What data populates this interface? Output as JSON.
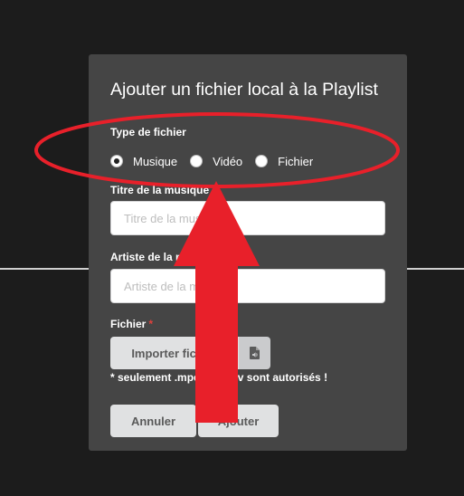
{
  "modal": {
    "title": "Ajouter un fichier local à la Playlist",
    "type_label": "Type de fichier",
    "radios": [
      {
        "label": "Musique",
        "checked": true
      },
      {
        "label": "Vidéo",
        "checked": false
      },
      {
        "label": "Fichier",
        "checked": false
      }
    ],
    "title_field": {
      "label": "Titre de la musique",
      "placeholder": "Titre de la musique"
    },
    "artist_field": {
      "label": "Artiste de la musique",
      "placeholder": "Artiste de la musique"
    },
    "file_field": {
      "label": "Fichier",
      "required_mark": "*",
      "button_label": "Importer fichier",
      "icon": "file-audio-icon"
    },
    "note": "* seulement .mpeg & .wav sont autorisés !",
    "cancel_label": "Annuler",
    "add_label": "Ajouter"
  },
  "annotation": {
    "ellipse_color": "#e8202a",
    "arrow_color": "#e8202a"
  }
}
